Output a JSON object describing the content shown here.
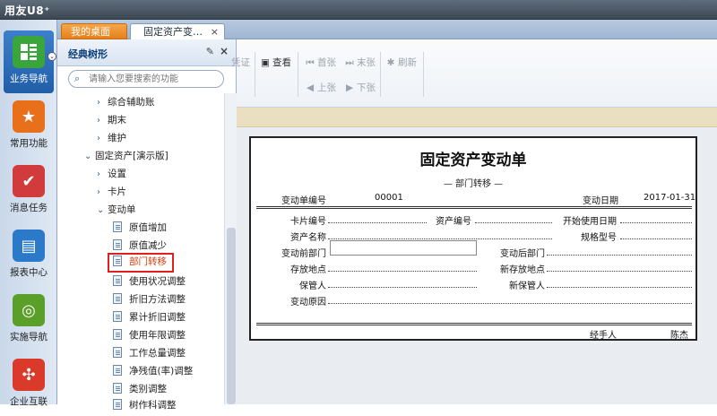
{
  "app": {
    "brand": "用友U8⁺"
  },
  "tabs": [
    {
      "label": "我的桌面"
    },
    {
      "label": "固定资产变…",
      "close": "×"
    }
  ],
  "iconbar": [
    {
      "label": "业务导航",
      "color": "#3aa53a",
      "icon": "business-nav-icon"
    },
    {
      "label": "常用功能",
      "color": "#e8701a",
      "icon": "star-icon"
    },
    {
      "label": "消息任务",
      "color": "#d23b3b",
      "icon": "message-task-icon"
    },
    {
      "label": "报表中心",
      "color": "#2b79c9",
      "icon": "report-icon"
    },
    {
      "label": "实施导航",
      "color": "#5aa028",
      "icon": "compass-icon"
    },
    {
      "label": "企业互联",
      "color": "#d93a2a",
      "icon": "enterprise-icon"
    }
  ],
  "tree": {
    "title": "经典树形",
    "pin": "📌",
    "close": "×",
    "search_placeholder": "请输入您要搜索的功能",
    "items": [
      {
        "label": "综合辅助账",
        "arrow": "›"
      },
      {
        "label": "期末",
        "arrow": "›"
      },
      {
        "label": "维护",
        "arrow": "›"
      },
      {
        "label": "固定资产[演示版]",
        "arrow": "⌄"
      },
      {
        "label": "设置",
        "arrow": "›"
      },
      {
        "label": "卡片",
        "arrow": "›"
      },
      {
        "label": "变动单",
        "arrow": "⌄"
      },
      {
        "label": "原值增加"
      },
      {
        "label": "原值减少"
      },
      {
        "label": "部门转移"
      },
      {
        "label": "使用状况调整"
      },
      {
        "label": "折旧方法调整"
      },
      {
        "label": "累计折旧调整"
      },
      {
        "label": "使用年限调整"
      },
      {
        "label": "工作总量调整"
      },
      {
        "label": "净残值(率)调整"
      },
      {
        "label": "类别调整"
      },
      {
        "label": "树作科调整"
      }
    ]
  },
  "toolbar": {
    "voucher": "凭证",
    "view": "查看",
    "first": "首张",
    "last": "末张",
    "refresh": "刷新",
    "prev": "上张",
    "next": "下张"
  },
  "form": {
    "title": "固定资产变动单",
    "subtitle": "— 部门转移 —",
    "no_label": "变动单编号",
    "no_value": "00001",
    "date_label": "变动日期",
    "date_value": "2017-01-31",
    "card_no": "卡片编号",
    "asset_no": "资产编号",
    "start_date": "开始使用日期",
    "asset_name": "资产名称",
    "spec": "规格型号",
    "dept_before": "变动前部门",
    "dept_after": "变动后部门",
    "loc_label": "存放地点",
    "new_loc": "新存放地点",
    "keeper": "保管人",
    "new_keeper": "新保管人",
    "reason": "变动原因",
    "handler_label": "经手人",
    "handler_value": "陈杰"
  }
}
